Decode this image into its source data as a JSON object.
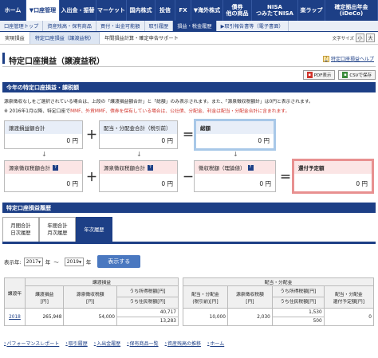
{
  "topnav": [
    {
      "label": "ホーム",
      "active": false,
      "width": 33
    },
    {
      "label": "▼口座管理",
      "active": true,
      "width": 42
    },
    {
      "label": "入出金・振替",
      "active": false,
      "width": 46
    },
    {
      "label": "マーケット",
      "active": false,
      "width": 38
    },
    {
      "label": "国内株式",
      "active": false,
      "width": 36
    },
    {
      "label": "投信",
      "active": false,
      "width": 25
    },
    {
      "label": "FX",
      "active": false,
      "width": 20
    },
    {
      "label": "▼海外株式",
      "active": false,
      "width": 40
    },
    {
      "label": "債券\n他の商品",
      "active": false,
      "width": 36
    },
    {
      "label": "NISA\nつみたてNISA",
      "active": false,
      "width": 58
    },
    {
      "label": "楽ラップ",
      "active": false,
      "width": 34
    },
    {
      "label": "確定拠出年金\n(iDeCo)",
      "active": false,
      "width": 66
    }
  ],
  "subnav": [
    {
      "label": "口座管理トップ",
      "active": false
    },
    {
      "label": "資産残高・保有商品",
      "active": false
    },
    {
      "label": "買付・出金可能額",
      "active": false
    },
    {
      "label": "取引履歴",
      "active": false
    },
    {
      "label": "損益・税金履歴",
      "active": true
    },
    {
      "label": "▶取引報告書等（電子書面）",
      "active": false
    }
  ],
  "thirdnav": [
    {
      "label": "実現損益",
      "active": false
    },
    {
      "label": "特定口座損益（譲渡益税）",
      "active": true
    },
    {
      "label": "年間損益計算・確定申告サポート",
      "active": false
    }
  ],
  "fontsize": {
    "label": "文字サイズ",
    "small": "小",
    "large": "大"
  },
  "page": {
    "title": "特定口座損益（譲渡益税）",
    "help": "特定口座損益ヘルプ",
    "pdf": "PDF表示",
    "csv": "CSVで保存"
  },
  "section1": {
    "title": "今年の特定口座損益・課税額",
    "note1": "源泉徴収なしをご選択されている場合は、上段の「譲渡損益額合計」と「総額」のみ表示されます。また、「源泉徴収税額計」は0円と表示されます。",
    "note2_prefix": "※ 2016年1月以降、特定口座で",
    "note2_red": "MMF、外貨MMF、債券を保有している場合は、公社債、分配金、利金は配当・分配金合計に含まれます。",
    "boxes": {
      "transfer_total": {
        "label": "譲渡損益額合計",
        "value": "0 円"
      },
      "dividend_total": {
        "label": "配当・分配金合計（税引前）",
        "value": "0 円"
      },
      "grand_total": {
        "label": "総額",
        "value": "0 円"
      },
      "withholding_total": {
        "label": "源泉徴収税額合計",
        "value": "0 円"
      },
      "withholding_total2": {
        "label": "源泉徴収税額合計",
        "value": "0 円"
      },
      "collected_tax": {
        "label": "徴収税額（理論値）",
        "value": "0 円"
      },
      "refund": {
        "label": "還付予定額",
        "value": "0 円"
      }
    },
    "ops": {
      "plus": "＋",
      "minus": "－",
      "eq": "＝",
      "down": "↓"
    }
  },
  "section2": {
    "title": "特定口座損益履歴",
    "tabs": [
      {
        "line1": "月間合計",
        "line2": "日次履歴",
        "active": false
      },
      {
        "line1": "年間合計",
        "line2": "月次履歴",
        "active": false
      },
      {
        "line1": "年次履歴",
        "line2": "",
        "active": true
      }
    ],
    "filter": {
      "prefix": "表示年:",
      "from_year": "2017",
      "year1": "年",
      "tilde": "〜",
      "to_year": "2019",
      "year2": "年",
      "button": "表示する"
    }
  },
  "table": {
    "group1": "譲渡損益",
    "group2": "配当・分配金",
    "headers": {
      "year": "譲渡年",
      "transfer": "譲渡損益\n[円]",
      "withholding": "源泉徴収税額\n[円]",
      "income_tax": "うち所得税額[円]",
      "resident_tax": "うち住民税額[円]",
      "div": "配当・分配金\n(税引前)[円]",
      "div_withholding": "源泉徴収税額\n[円]",
      "div_income_tax": "うち所得税額[円]",
      "div_resident_tax": "うち住民税額[円]",
      "div_refund": "配当・分配金\n還付予定額[円]"
    },
    "rows": [
      {
        "year": "2018",
        "transfer": "265,948",
        "withholding": "54,000",
        "income_tax": "40,717",
        "resident_tax": "13,283",
        "div": "10,000",
        "div_withholding": "2,030",
        "div_income_tax": "1,530",
        "div_resident_tax": "500",
        "div_refund": "0"
      }
    ]
  },
  "footlinks": [
    "パフォーマンスレポート",
    "取引履歴",
    "入出金履歴",
    "保有商品一覧",
    "資産残高の推移",
    "ホーム"
  ]
}
